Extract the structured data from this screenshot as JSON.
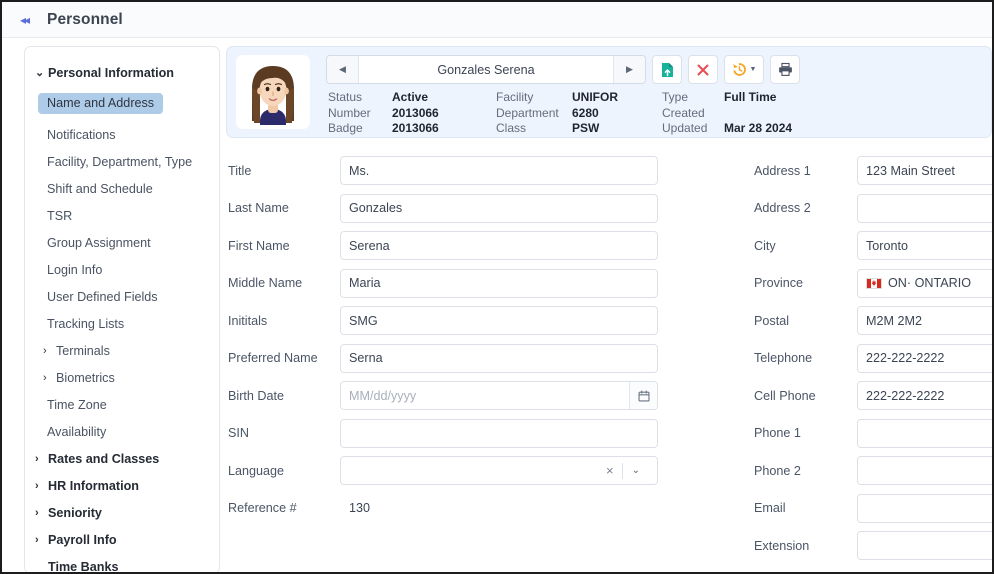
{
  "topbar": {
    "collapse_glyph": "◂◂",
    "title": "Personnel"
  },
  "sidebar": {
    "items": [
      {
        "label": "Personal Information",
        "type": "group",
        "caret": "⌄",
        "expanded": true
      },
      {
        "label": "Name and Address",
        "type": "selected"
      },
      {
        "label": "Notifications",
        "type": "item"
      },
      {
        "label": "Facility, Department, Type",
        "type": "item"
      },
      {
        "label": "Shift and Schedule",
        "type": "item"
      },
      {
        "label": "TSR",
        "type": "item"
      },
      {
        "label": "Group Assignment",
        "type": "item"
      },
      {
        "label": "Login Info",
        "type": "item"
      },
      {
        "label": "User Defined Fields",
        "type": "item"
      },
      {
        "label": "Tracking Lists",
        "type": "item"
      },
      {
        "label": "Terminals",
        "type": "child-caret",
        "caret": "›"
      },
      {
        "label": "Biometrics",
        "type": "child-caret",
        "caret": "›"
      },
      {
        "label": "Time Zone",
        "type": "item"
      },
      {
        "label": "Availability",
        "type": "item"
      },
      {
        "label": "Rates and Classes",
        "type": "group",
        "caret": "›"
      },
      {
        "label": "HR Information",
        "type": "group",
        "caret": "›"
      },
      {
        "label": "Seniority",
        "type": "group",
        "caret": "›"
      },
      {
        "label": "Payroll Info",
        "type": "group",
        "caret": "›"
      },
      {
        "label": "Time Banks",
        "type": "group-nocaret"
      }
    ]
  },
  "header": {
    "avatar_alt": "employee-photo",
    "nav": {
      "prev_glyph": "◀",
      "next_glyph": "▶",
      "employee_name": "Gonzales Serena"
    },
    "actions": [
      {
        "name": "save-document-button",
        "icon": "document-upload-icon",
        "color": "#16b39a"
      },
      {
        "name": "delete-button",
        "icon": "close-x-icon",
        "color": "#ea4c52"
      },
      {
        "name": "history-button",
        "icon": "history-undo-icon",
        "color": "#f5a623",
        "has_caret": true,
        "caret_glyph": "▼"
      },
      {
        "name": "print-button",
        "icon": "printer-icon",
        "color": "#4c5566"
      }
    ],
    "info": {
      "col1": {
        "labels": [
          "Status",
          "Number",
          "Badge"
        ],
        "values": [
          "Active",
          "2013066",
          "2013066"
        ]
      },
      "col2": {
        "labels": [
          "Facility",
          "Department",
          "Class"
        ],
        "values": [
          "UNIFOR",
          "6280",
          "PSW"
        ]
      },
      "col3": {
        "labels": [
          "Type",
          "Created",
          "Updated"
        ],
        "values": [
          "Full Time",
          "",
          "Mar 28 2024"
        ]
      }
    }
  },
  "form": {
    "left": [
      {
        "label": "Title",
        "value": "Ms.",
        "name": "title-field"
      },
      {
        "label": "Last Name",
        "value": "Gonzales",
        "name": "last-name-field"
      },
      {
        "label": "First Name",
        "value": "Serena",
        "name": "first-name-field"
      },
      {
        "label": "Middle Name",
        "value": "Maria",
        "name": "middle-name-field"
      },
      {
        "label": "Inititals",
        "value": "SMG",
        "name": "initials-field"
      },
      {
        "label": "Preferred Name",
        "value": "Serna",
        "name": "preferred-name-field"
      },
      {
        "label": "Birth Date",
        "value": "",
        "placeholder": "MM/dd/yyyy",
        "name": "birth-date-field",
        "addon": "calendar-icon"
      },
      {
        "label": "SIN",
        "value": "",
        "name": "sin-field"
      },
      {
        "label": "Language",
        "value": "",
        "name": "language-select",
        "controls": "clear-and-chevron"
      },
      {
        "label": "Reference #",
        "value": "130",
        "name": "reference-number-value",
        "static": true
      }
    ],
    "right": [
      {
        "label": "Address 1",
        "value": "123 Main Street",
        "name": "address-1-field"
      },
      {
        "label": "Address 2",
        "value": "",
        "name": "address-2-field"
      },
      {
        "label": "City",
        "value": "Toronto",
        "name": "city-field"
      },
      {
        "label": "Province",
        "value": "ON· ONTARIO",
        "name": "province-field",
        "flag": "canada-flag-icon"
      },
      {
        "label": "Postal",
        "value": "M2M 2M2",
        "name": "postal-field"
      },
      {
        "label": "Telephone",
        "value": "222-222-2222",
        "name": "telephone-field"
      },
      {
        "label": "Cell Phone",
        "value": "222-222-2222",
        "name": "cell-phone-field"
      },
      {
        "label": "Phone 1",
        "value": "",
        "name": "phone-1-field"
      },
      {
        "label": "Phone 2",
        "value": "",
        "name": "phone-2-field"
      },
      {
        "label": "Email",
        "value": "",
        "name": "email-field"
      },
      {
        "label": "Extension",
        "value": "",
        "name": "extension-field"
      }
    ]
  },
  "colors": {
    "accent": "#5b6fd6",
    "header_card_bg": "#eef4fd",
    "selected_nav": "#aecbe8",
    "save_green": "#16b39a",
    "delete_red": "#ea4c52",
    "history_orange": "#f5a623"
  }
}
